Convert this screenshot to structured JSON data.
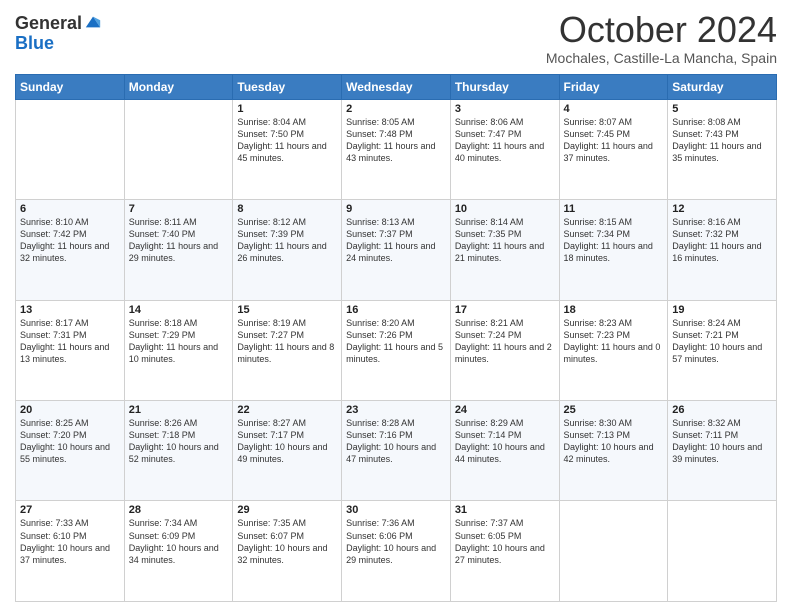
{
  "header": {
    "logo_line1": "General",
    "logo_line2": "Blue",
    "month": "October 2024",
    "location": "Mochales, Castille-La Mancha, Spain"
  },
  "weekdays": [
    "Sunday",
    "Monday",
    "Tuesday",
    "Wednesday",
    "Thursday",
    "Friday",
    "Saturday"
  ],
  "weeks": [
    [
      {
        "day": "",
        "sunrise": "",
        "sunset": "",
        "daylight": ""
      },
      {
        "day": "",
        "sunrise": "",
        "sunset": "",
        "daylight": ""
      },
      {
        "day": "1",
        "sunrise": "Sunrise: 8:04 AM",
        "sunset": "Sunset: 7:50 PM",
        "daylight": "Daylight: 11 hours and 45 minutes."
      },
      {
        "day": "2",
        "sunrise": "Sunrise: 8:05 AM",
        "sunset": "Sunset: 7:48 PM",
        "daylight": "Daylight: 11 hours and 43 minutes."
      },
      {
        "day": "3",
        "sunrise": "Sunrise: 8:06 AM",
        "sunset": "Sunset: 7:47 PM",
        "daylight": "Daylight: 11 hours and 40 minutes."
      },
      {
        "day": "4",
        "sunrise": "Sunrise: 8:07 AM",
        "sunset": "Sunset: 7:45 PM",
        "daylight": "Daylight: 11 hours and 37 minutes."
      },
      {
        "day": "5",
        "sunrise": "Sunrise: 8:08 AM",
        "sunset": "Sunset: 7:43 PM",
        "daylight": "Daylight: 11 hours and 35 minutes."
      }
    ],
    [
      {
        "day": "6",
        "sunrise": "Sunrise: 8:10 AM",
        "sunset": "Sunset: 7:42 PM",
        "daylight": "Daylight: 11 hours and 32 minutes."
      },
      {
        "day": "7",
        "sunrise": "Sunrise: 8:11 AM",
        "sunset": "Sunset: 7:40 PM",
        "daylight": "Daylight: 11 hours and 29 minutes."
      },
      {
        "day": "8",
        "sunrise": "Sunrise: 8:12 AM",
        "sunset": "Sunset: 7:39 PM",
        "daylight": "Daylight: 11 hours and 26 minutes."
      },
      {
        "day": "9",
        "sunrise": "Sunrise: 8:13 AM",
        "sunset": "Sunset: 7:37 PM",
        "daylight": "Daylight: 11 hours and 24 minutes."
      },
      {
        "day": "10",
        "sunrise": "Sunrise: 8:14 AM",
        "sunset": "Sunset: 7:35 PM",
        "daylight": "Daylight: 11 hours and 21 minutes."
      },
      {
        "day": "11",
        "sunrise": "Sunrise: 8:15 AM",
        "sunset": "Sunset: 7:34 PM",
        "daylight": "Daylight: 11 hours and 18 minutes."
      },
      {
        "day": "12",
        "sunrise": "Sunrise: 8:16 AM",
        "sunset": "Sunset: 7:32 PM",
        "daylight": "Daylight: 11 hours and 16 minutes."
      }
    ],
    [
      {
        "day": "13",
        "sunrise": "Sunrise: 8:17 AM",
        "sunset": "Sunset: 7:31 PM",
        "daylight": "Daylight: 11 hours and 13 minutes."
      },
      {
        "day": "14",
        "sunrise": "Sunrise: 8:18 AM",
        "sunset": "Sunset: 7:29 PM",
        "daylight": "Daylight: 11 hours and 10 minutes."
      },
      {
        "day": "15",
        "sunrise": "Sunrise: 8:19 AM",
        "sunset": "Sunset: 7:27 PM",
        "daylight": "Daylight: 11 hours and 8 minutes."
      },
      {
        "day": "16",
        "sunrise": "Sunrise: 8:20 AM",
        "sunset": "Sunset: 7:26 PM",
        "daylight": "Daylight: 11 hours and 5 minutes."
      },
      {
        "day": "17",
        "sunrise": "Sunrise: 8:21 AM",
        "sunset": "Sunset: 7:24 PM",
        "daylight": "Daylight: 11 hours and 2 minutes."
      },
      {
        "day": "18",
        "sunrise": "Sunrise: 8:23 AM",
        "sunset": "Sunset: 7:23 PM",
        "daylight": "Daylight: 11 hours and 0 minutes."
      },
      {
        "day": "19",
        "sunrise": "Sunrise: 8:24 AM",
        "sunset": "Sunset: 7:21 PM",
        "daylight": "Daylight: 10 hours and 57 minutes."
      }
    ],
    [
      {
        "day": "20",
        "sunrise": "Sunrise: 8:25 AM",
        "sunset": "Sunset: 7:20 PM",
        "daylight": "Daylight: 10 hours and 55 minutes."
      },
      {
        "day": "21",
        "sunrise": "Sunrise: 8:26 AM",
        "sunset": "Sunset: 7:18 PM",
        "daylight": "Daylight: 10 hours and 52 minutes."
      },
      {
        "day": "22",
        "sunrise": "Sunrise: 8:27 AM",
        "sunset": "Sunset: 7:17 PM",
        "daylight": "Daylight: 10 hours and 49 minutes."
      },
      {
        "day": "23",
        "sunrise": "Sunrise: 8:28 AM",
        "sunset": "Sunset: 7:16 PM",
        "daylight": "Daylight: 10 hours and 47 minutes."
      },
      {
        "day": "24",
        "sunrise": "Sunrise: 8:29 AM",
        "sunset": "Sunset: 7:14 PM",
        "daylight": "Daylight: 10 hours and 44 minutes."
      },
      {
        "day": "25",
        "sunrise": "Sunrise: 8:30 AM",
        "sunset": "Sunset: 7:13 PM",
        "daylight": "Daylight: 10 hours and 42 minutes."
      },
      {
        "day": "26",
        "sunrise": "Sunrise: 8:32 AM",
        "sunset": "Sunset: 7:11 PM",
        "daylight": "Daylight: 10 hours and 39 minutes."
      }
    ],
    [
      {
        "day": "27",
        "sunrise": "Sunrise: 7:33 AM",
        "sunset": "Sunset: 6:10 PM",
        "daylight": "Daylight: 10 hours and 37 minutes."
      },
      {
        "day": "28",
        "sunrise": "Sunrise: 7:34 AM",
        "sunset": "Sunset: 6:09 PM",
        "daylight": "Daylight: 10 hours and 34 minutes."
      },
      {
        "day": "29",
        "sunrise": "Sunrise: 7:35 AM",
        "sunset": "Sunset: 6:07 PM",
        "daylight": "Daylight: 10 hours and 32 minutes."
      },
      {
        "day": "30",
        "sunrise": "Sunrise: 7:36 AM",
        "sunset": "Sunset: 6:06 PM",
        "daylight": "Daylight: 10 hours and 29 minutes."
      },
      {
        "day": "31",
        "sunrise": "Sunrise: 7:37 AM",
        "sunset": "Sunset: 6:05 PM",
        "daylight": "Daylight: 10 hours and 27 minutes."
      },
      {
        "day": "",
        "sunrise": "",
        "sunset": "",
        "daylight": ""
      },
      {
        "day": "",
        "sunrise": "",
        "sunset": "",
        "daylight": ""
      }
    ]
  ]
}
